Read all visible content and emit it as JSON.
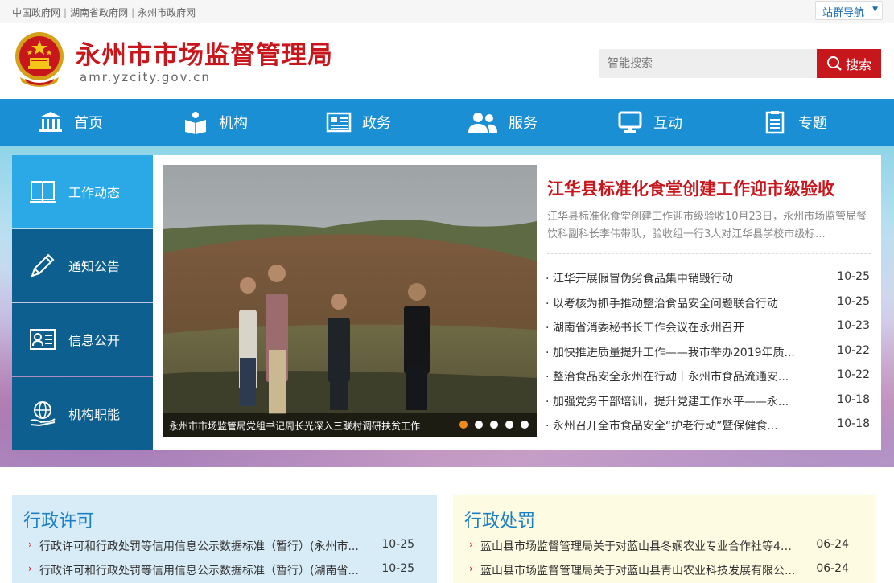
{
  "topbar": {
    "links": [
      "中国政府网",
      "湖南省政府网",
      "永州市政府网"
    ],
    "site_nav_label": "站群导航"
  },
  "header": {
    "title": "永州市市场监督管理局",
    "domain": "amr.yzcity.gov.cn",
    "search_placeholder": "智能搜索",
    "search_button": "搜索"
  },
  "nav": {
    "items": [
      {
        "label": "首页",
        "icon": "building-icon"
      },
      {
        "label": "机构",
        "icon": "book-icon"
      },
      {
        "label": "政务",
        "icon": "newspaper-icon"
      },
      {
        "label": "服务",
        "icon": "users-icon"
      },
      {
        "label": "互动",
        "icon": "monitor-icon"
      },
      {
        "label": "专题",
        "icon": "document-icon"
      }
    ]
  },
  "sidemenu": {
    "items": [
      {
        "label": "工作动态",
        "icon": "open-book-icon"
      },
      {
        "label": "通知公告",
        "icon": "pen-icon"
      },
      {
        "label": "信息公开",
        "icon": "id-card-icon"
      },
      {
        "label": "机构职能",
        "icon": "globe-hand-icon"
      }
    ]
  },
  "slide": {
    "caption": "永州市市场监管局党组书记周长光深入三联村调研扶贫工作",
    "dots": 5,
    "active_dot": 0
  },
  "headline": {
    "title": "江华县标准化食堂创建工作迎市级验收",
    "summary": "江华县标准化食堂创建工作迎市级验收10月23日，永州市场监管局餐饮科副科长李伟带队，验收组一行3人对江华县学校市级标..."
  },
  "news": [
    {
      "title": "· 江华开展假冒伪劣食品集中销毁行动",
      "date": "10-25"
    },
    {
      "title": "· 以考核为抓手推动整治食品安全问题联合行动",
      "date": "10-25"
    },
    {
      "title": "· 湖南省消委秘书长工作会议在永州召开",
      "date": "10-23"
    },
    {
      "title": "· 加快推进质量提升工作——我市举办2019年质...",
      "date": "10-22"
    },
    {
      "title": "· 整治食品安全永州在行动｜永州市食品流通安...",
      "date": "10-22"
    },
    {
      "title": "· 加强党务干部培训，提升党建工作水平——永...",
      "date": "10-18"
    },
    {
      "title": "· 永州召开全市食品安全“护老行动”暨保健食...",
      "date": "10-18"
    }
  ],
  "panels": {
    "left": {
      "title": "行政许可",
      "rows": [
        {
          "title": "行政许可和行政处罚等信用信息公示数据标准（暂行）(永州市...",
          "date": "10-25"
        },
        {
          "title": "行政许可和行政处罚等信用信息公示数据标准（暂行）(湖南省...",
          "date": "10-25"
        }
      ]
    },
    "right": {
      "title": "行政处罚",
      "rows": [
        {
          "title": "蓝山县市场监督管理局关于对蓝山县冬娴农业专业合作社等47...",
          "date": "06-24"
        },
        {
          "title": "蓝山县市场监督管理局关于对蓝山县青山农业科技发展有限公...",
          "date": "06-24"
        }
      ]
    }
  },
  "colors": {
    "brand_red": "#c8161d",
    "nav_blue": "#1b8fd3",
    "side_dark": "#0d5f8f",
    "side_active": "#2aa9e6",
    "dot_active": "#f08a1c"
  }
}
